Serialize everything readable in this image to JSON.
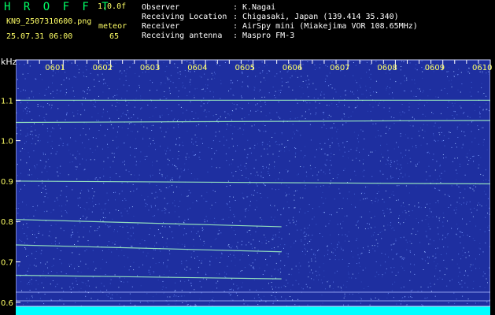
{
  "header": {
    "app_title": "H R O F F T",
    "version": "1.0.0f",
    "filename": "KN9_2507310600.png",
    "datetime": "25.07.31 06:00",
    "meteor_label": "meteor",
    "meteor_count": "65",
    "info": [
      {
        "label": "Observer",
        "value": "K.Nagai"
      },
      {
        "label": "Receiving Location",
        "value": "Chigasaki, Japan (139.414 35.340)"
      },
      {
        "label": "Receiver",
        "value": "AirSpy mini (Miakejima VOR 108.65MHz)"
      },
      {
        "label": "Receiving antenna",
        "value": "Maspro FM-3"
      }
    ]
  },
  "colors": {
    "background": "#1e2fa0",
    "trace": "#9ef0c0",
    "header_text": "#ffffff",
    "accent_text": "#ffff66",
    "title_text": "#00ff66",
    "tick_label": "#ffff66",
    "bottom_band": "#00ffff"
  },
  "chart_data": {
    "type": "heatmap",
    "title": "",
    "ylabel": "kHz",
    "x_ticks": [
      "0601",
      "0602",
      "0603",
      "0604",
      "0605",
      "0606",
      "0607",
      "0608",
      "0609",
      "0610"
    ],
    "x_range_minutes": [
      0,
      10
    ],
    "y_ticks": [
      1.1,
      1.0,
      0.9,
      0.8,
      0.7,
      0.6
    ],
    "y_range_khz": [
      0.59,
      1.2
    ],
    "lines": [
      {
        "x_start": 0,
        "x_end": 10,
        "y_start": 1.1,
        "y_end": 1.1
      },
      {
        "x_start": 0,
        "x_end": 10,
        "y_start": 1.045,
        "y_end": 1.05
      },
      {
        "x_start": 0,
        "x_end": 10,
        "y_start": 0.9,
        "y_end": 0.893
      },
      {
        "x_start": 0,
        "x_end": 5.6,
        "y_start": 0.805,
        "y_end": 0.787
      },
      {
        "x_start": 0,
        "x_end": 5.6,
        "y_start": 0.742,
        "y_end": 0.725
      },
      {
        "x_start": 0,
        "x_end": 5.6,
        "y_start": 0.667,
        "y_end": 0.658
      }
    ]
  }
}
